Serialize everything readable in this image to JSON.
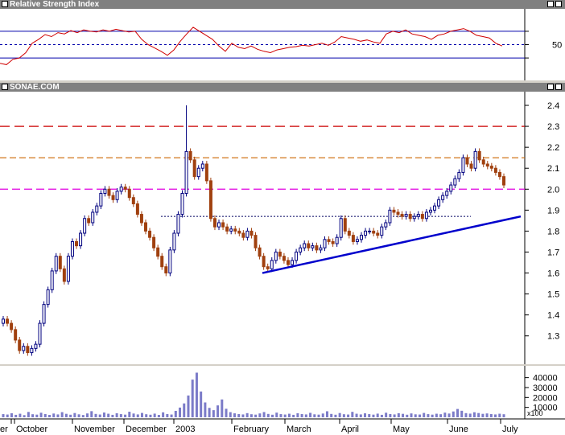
{
  "panels": {
    "rsi_title": "Relative Strength Index",
    "price_title": "SONAE.COM"
  },
  "colors": {
    "up": "#00007f",
    "down": "#a0400f",
    "rsi_line": "#d00000",
    "trend": "#0000cc",
    "res_red": "#cc0000",
    "res_orange": "#cc6600",
    "res_magenta": "#e000e0",
    "volume": "#7b7bc8"
  },
  "chart_data": [
    {
      "type": "line",
      "title": "Relative Strength Index",
      "ylim": [
        0,
        100
      ],
      "y_ticks": [
        "50"
      ],
      "reference_lines": [
        70,
        50,
        30
      ],
      "series": [
        {
          "x": [
            0,
            8,
            16,
            24,
            32,
            40,
            48,
            56,
            64,
            72,
            80,
            88,
            96,
            104,
            112,
            120,
            128,
            136,
            144,
            152,
            160,
            168,
            176,
            184,
            192,
            200,
            208,
            216,
            224,
            232,
            240,
            248,
            256,
            264,
            272,
            280,
            288,
            296,
            304,
            312,
            320,
            328,
            336,
            344,
            352,
            360,
            368,
            376,
            384,
            392,
            400,
            408,
            416,
            424,
            432,
            440,
            448,
            456,
            464,
            472,
            480,
            488,
            496,
            504,
            512,
            520,
            528,
            536,
            544,
            552,
            560,
            568,
            576,
            584,
            592,
            600,
            608,
            616,
            624
          ],
          "values": [
            22,
            20,
            28,
            30,
            38,
            52,
            58,
            65,
            62,
            68,
            66,
            71,
            68,
            72,
            70,
            69,
            72,
            70,
            73,
            71,
            69,
            70,
            58,
            50,
            45,
            40,
            34,
            42,
            55,
            66,
            76,
            70,
            64,
            58,
            48,
            40,
            52,
            46,
            44,
            48,
            43,
            40,
            38,
            42,
            44,
            46,
            47,
            49,
            48,
            50,
            52,
            49,
            54,
            62,
            60,
            58,
            55,
            57,
            54,
            52,
            66,
            70,
            68,
            72,
            66,
            64,
            62,
            58,
            64,
            66,
            70,
            72,
            74,
            70,
            64,
            62,
            60,
            52,
            48
          ]
        }
      ]
    },
    {
      "type": "candlestick",
      "title": "SONAE.COM",
      "ylim": [
        1.18,
        2.45
      ],
      "y_ticks": [
        "2.4",
        "2.3",
        "2.2",
        "2.1",
        "2.0",
        "1.9",
        "1.8",
        "1.7",
        "1.6",
        "1.5",
        "1.4",
        "1.3"
      ],
      "x_ticks": [
        "er",
        "October",
        "November",
        "December",
        "2003",
        "February",
        "March",
        "April",
        "May",
        "June",
        "July"
      ],
      "close": [
        1.38,
        1.36,
        1.33,
        1.28,
        1.23,
        1.25,
        1.22,
        1.24,
        1.26,
        1.36,
        1.45,
        1.52,
        1.61,
        1.68,
        1.62,
        1.56,
        1.68,
        1.75,
        1.73,
        1.79,
        1.86,
        1.84,
        1.89,
        1.92,
        1.98,
        2.0,
        1.97,
        1.95,
        1.99,
        2.01,
        2.0,
        1.96,
        1.93,
        1.88,
        1.84,
        1.8,
        1.77,
        1.72,
        1.68,
        1.63,
        1.6,
        1.71,
        1.79,
        1.88,
        1.98,
        2.18,
        2.14,
        2.06,
        2.1,
        2.12,
        2.04,
        1.86,
        1.82,
        1.84,
        1.82,
        1.8,
        1.81,
        1.8,
        1.79,
        1.77,
        1.8,
        1.78,
        1.72,
        1.68,
        1.63,
        1.62,
        1.66,
        1.7,
        1.68,
        1.66,
        1.64,
        1.66,
        1.7,
        1.72,
        1.74,
        1.72,
        1.73,
        1.71,
        1.72,
        1.76,
        1.75,
        1.74,
        1.77,
        1.86,
        1.8,
        1.78,
        1.75,
        1.76,
        1.78,
        1.8,
        1.8,
        1.79,
        1.78,
        1.82,
        1.84,
        1.9,
        1.89,
        1.88,
        1.87,
        1.88,
        1.86,
        1.87,
        1.88,
        1.86,
        1.89,
        1.9,
        1.92,
        1.95,
        1.97,
        1.99,
        2.02,
        2.05,
        2.08,
        2.15,
        2.12,
        2.1,
        2.18,
        2.14,
        2.12,
        2.11,
        2.1,
        2.08,
        2.06,
        2.02
      ]
    },
    {
      "type": "bar",
      "title": "",
      "ylim": [
        0,
        47000
      ],
      "y_ticks": [
        "40000",
        "30000",
        "20000",
        "10000"
      ],
      "y_multiplier": "x100",
      "values": [
        3200,
        2800,
        4100,
        2500,
        3600,
        2200,
        5400,
        3100,
        2700,
        4600,
        3300,
        2400,
        3800,
        2900,
        5200,
        3500,
        2600,
        4300,
        3000,
        2300,
        3900,
        6200,
        3400,
        2800,
        4800,
        3600,
        2500,
        4100,
        3200,
        2700,
        5600,
        3800,
        2900,
        4400,
        3100,
        2600,
        3700,
        2400,
        5000,
        3300,
        2800,
        6500,
        9800,
        14000,
        22000,
        38000,
        45000,
        26000,
        15000,
        9500,
        7200,
        12000,
        18000,
        8600,
        5200,
        4000,
        3300,
        2900,
        4200,
        3100,
        2700,
        3900,
        5300,
        3400,
        2600,
        4700,
        3200,
        2800,
        3600,
        2500,
        4100,
        3300,
        2900,
        4500,
        3000,
        2700,
        3800,
        6100,
        3400,
        2600,
        4300,
        3100,
        2800,
        5500,
        3600,
        2900,
        4000,
        3200,
        2700,
        3700,
        2500,
        4600,
        3300,
        2900,
        4100,
        3500,
        2600,
        3900,
        3000,
        2800,
        4400,
        3200,
        2700,
        3600,
        3100,
        4700,
        3800,
        5900,
        8400,
        6600,
        4200,
        3700,
        5100,
        4300,
        3500,
        3900,
        3300,
        2900,
        3600,
        3100
      ]
    }
  ]
}
